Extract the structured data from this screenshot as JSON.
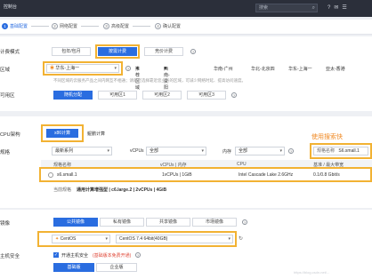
{
  "topbar": {
    "brand": "控制台",
    "search_placeholder": "搜索",
    "icons": [
      "search-icon",
      "help-icon",
      "message-icon",
      "user-icon"
    ]
  },
  "steps": [
    {
      "num": "1",
      "label": "基础配置"
    },
    {
      "num": "2",
      "label": "网络配置"
    },
    {
      "num": "3",
      "label": "高级配置"
    },
    {
      "num": "4",
      "label": "确认配置"
    }
  ],
  "billing": {
    "label": "计费模式",
    "options": [
      "包年/包月",
      "按需计费",
      "竞价计费"
    ]
  },
  "region": {
    "label": "区域",
    "value": "华东-上海一",
    "recommend": "推荐区域",
    "others": [
      "西南-贵阳一",
      "华南-广州",
      "华北-北京四",
      "华东-上海一",
      "亚太-香港"
    ],
    "note": "不同区域的云服务产品之间内网互不相通；请就近选择靠近您业务的区域，可减少网络时延、提高访问速度。"
  },
  "az": {
    "label": "可用区",
    "options": [
      "随机分配",
      "可用区1",
      "可用区2",
      "可用区3"
    ]
  },
  "cpu_arch": {
    "label": "CPU架构",
    "options": [
      "x86计算",
      "鲲鹏计算"
    ]
  },
  "spec": {
    "label": "规格",
    "family": "最新系列",
    "vcpus_label": "vCPUs",
    "vcpus_value": "全部",
    "mem_label": "内存",
    "mem_value": "全部",
    "name_label": "规格名称",
    "name_value": "S6.small.1",
    "annotation": "使用搜索快",
    "cols": [
      "规格名称",
      "vCPUs | 内存",
      "CPU",
      "基准 / 最大带宽"
    ],
    "row": {
      "name": "s6.small.1",
      "vcpu_mem": "1vCPUs | 1GiB",
      "cpu": "Intel Cascade Lake 2.6GHz",
      "bw": "0.1/0.8 Gbit/s"
    },
    "current_label": "当前规格",
    "current_value": "通用计算增强型 | c6.large.2 | 2vCPUs | 4GiB"
  },
  "image": {
    "label": "镜像",
    "tabs": [
      "公共镜像",
      "私有镜像",
      "共享镜像",
      "市场镜像"
    ],
    "os": "CentOS",
    "version": "CentOS 7.4 64bit(40GB)"
  },
  "security": {
    "label": "主机安全",
    "check": "开通主机安全",
    "note": "(基础版本免费开通)",
    "editions": [
      "基础版",
      "企业版"
    ]
  },
  "watermark": "https://blog.csdn.net/..."
}
